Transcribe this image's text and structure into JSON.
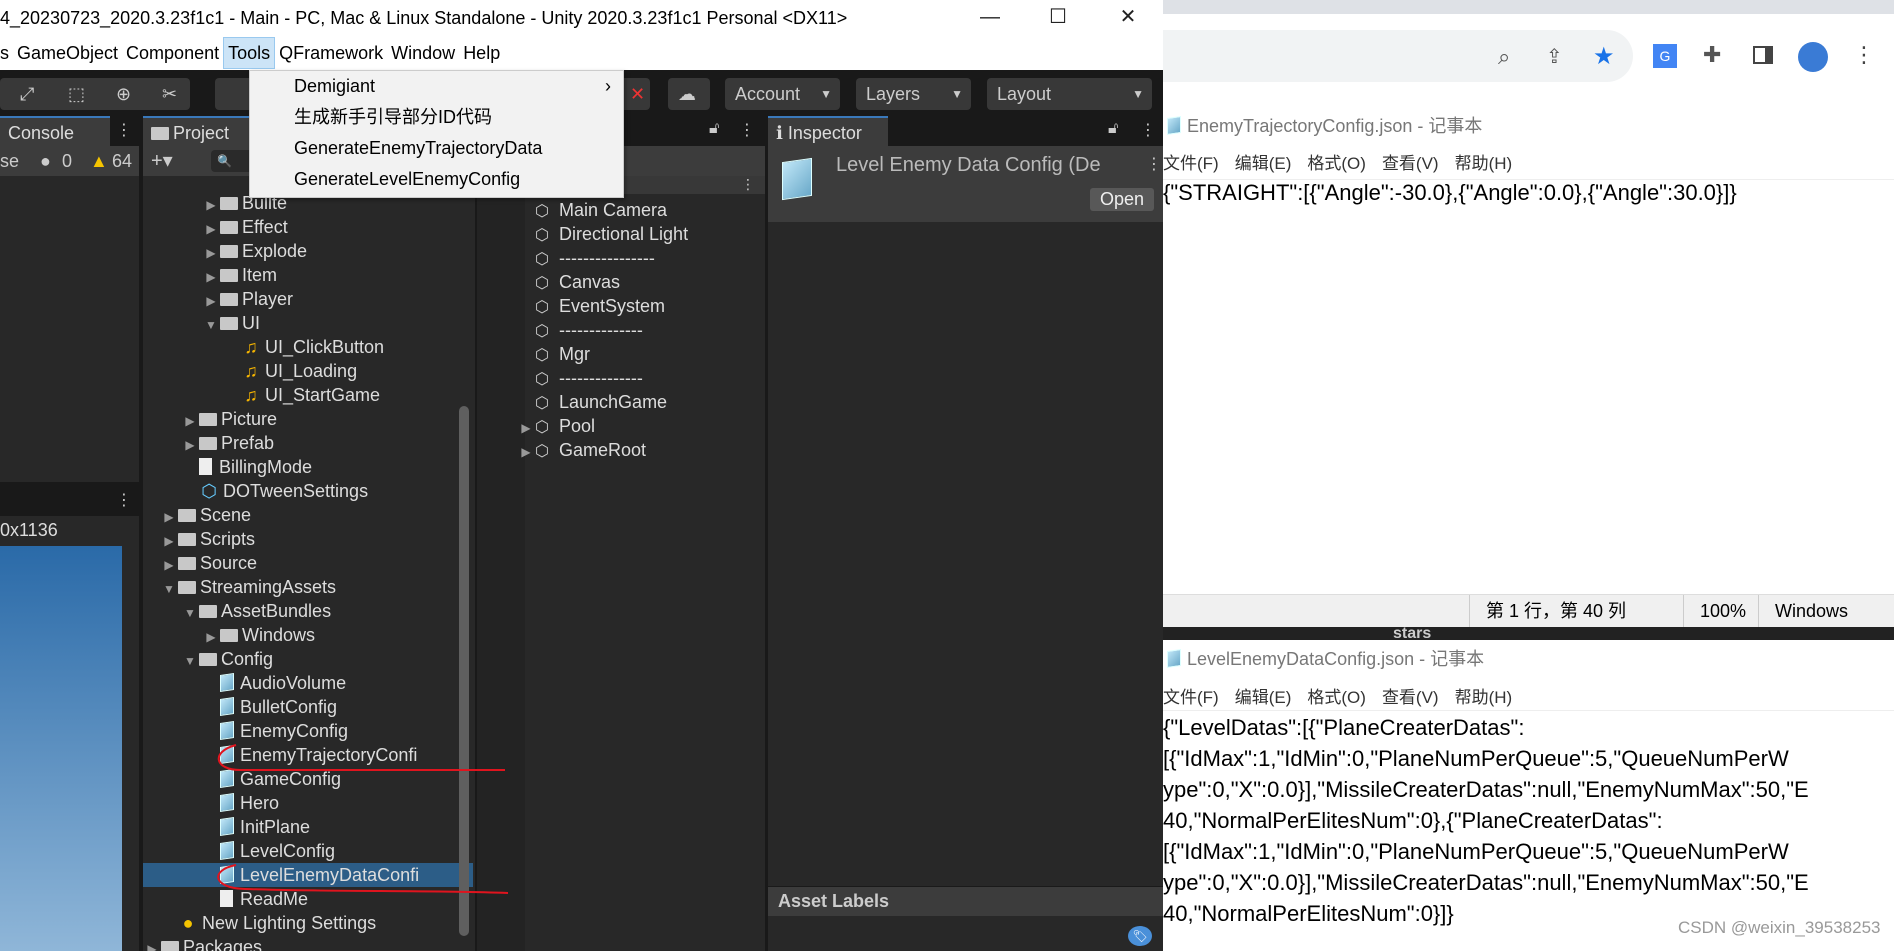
{
  "unity": {
    "title": "4_20230723_2020.3.23f1c1 - Main - PC, Mac & Linux Standalone - Unity 2020.3.23f1c1 Personal <DX11>",
    "menu": [
      "s",
      "GameObject",
      "Component",
      "Tools",
      "QFramework",
      "Window",
      "Help"
    ],
    "tools_menu": [
      "Demigiant",
      "生成新手引导部分ID代码",
      "GenerateEnemyTrajectoryData",
      "GenerateLevelEnemyConfig"
    ],
    "toolbar": {
      "account": "Account",
      "layers": "Layers",
      "layout": "Layout"
    },
    "console": {
      "tab": "Console",
      "collapse": "se",
      "error_count": "0",
      "warning_count": "64"
    },
    "game": {
      "resolution": "0x1136"
    },
    "project": {
      "tab": "Project",
      "items": [
        {
          "label": "Bullte",
          "depth": 3,
          "type": "folder",
          "arrow": "right"
        },
        {
          "label": "Effect",
          "depth": 3,
          "type": "folder",
          "arrow": "right"
        },
        {
          "label": "Explode",
          "depth": 3,
          "type": "folder",
          "arrow": "right"
        },
        {
          "label": "Item",
          "depth": 3,
          "type": "folder",
          "arrow": "right"
        },
        {
          "label": "Player",
          "depth": 3,
          "type": "folder",
          "arrow": "right"
        },
        {
          "label": "UI",
          "depth": 3,
          "type": "folder",
          "arrow": "down"
        },
        {
          "label": "UI_ClickButton",
          "depth": 4,
          "type": "audio"
        },
        {
          "label": "UI_Loading",
          "depth": 4,
          "type": "audio"
        },
        {
          "label": "UI_StartGame",
          "depth": 4,
          "type": "audio"
        },
        {
          "label": "Picture",
          "depth": 2,
          "type": "folder",
          "arrow": "right"
        },
        {
          "label": "Prefab",
          "depth": 2,
          "type": "folder",
          "arrow": "right"
        },
        {
          "label": "BillingMode",
          "depth": 2,
          "type": "file"
        },
        {
          "label": "DOTweenSettings",
          "depth": 2,
          "type": "asset"
        },
        {
          "label": "Scene",
          "depth": 1,
          "type": "folder",
          "arrow": "right"
        },
        {
          "label": "Scripts",
          "depth": 1,
          "type": "folder",
          "arrow": "right"
        },
        {
          "label": "Source",
          "depth": 1,
          "type": "folder",
          "arrow": "right"
        },
        {
          "label": "StreamingAssets",
          "depth": 1,
          "type": "folder",
          "arrow": "down"
        },
        {
          "label": "AssetBundles",
          "depth": 2,
          "type": "folder",
          "arrow": "down"
        },
        {
          "label": "Windows",
          "depth": 3,
          "type": "folder",
          "arrow": "right"
        },
        {
          "label": "Config",
          "depth": 2,
          "type": "folder",
          "arrow": "down"
        },
        {
          "label": "AudioVolume",
          "depth": 3,
          "type": "json"
        },
        {
          "label": "BulletConfig",
          "depth": 3,
          "type": "json"
        },
        {
          "label": "EnemyConfig",
          "depth": 3,
          "type": "json"
        },
        {
          "label": "EnemyTrajectoryConfi",
          "depth": 3,
          "type": "json"
        },
        {
          "label": "GameConfig",
          "depth": 3,
          "type": "json"
        },
        {
          "label": "Hero",
          "depth": 3,
          "type": "json"
        },
        {
          "label": "InitPlane",
          "depth": 3,
          "type": "json"
        },
        {
          "label": "LevelConfig",
          "depth": 3,
          "type": "json"
        },
        {
          "label": "LevelEnemyDataConfi",
          "depth": 3,
          "type": "json",
          "selected": true
        },
        {
          "label": "ReadMe",
          "depth": 3,
          "type": "file"
        },
        {
          "label": "New Lighting Settings",
          "depth": 1,
          "type": "light"
        },
        {
          "label": "Packages",
          "depth": 0,
          "type": "folder",
          "arrow": "right"
        }
      ]
    },
    "hierarchy": {
      "items": [
        {
          "label": "Main Camera"
        },
        {
          "label": "Directional Light"
        },
        {
          "label": "----------------"
        },
        {
          "label": "Canvas"
        },
        {
          "label": "EventSystem"
        },
        {
          "label": "--------------"
        },
        {
          "label": "Mgr"
        },
        {
          "label": "--------------"
        },
        {
          "label": "LaunchGame"
        },
        {
          "label": "Pool",
          "arrow": true
        },
        {
          "label": "GameRoot",
          "arrow": true
        }
      ]
    },
    "inspector": {
      "tab": "Inspector",
      "asset_name": "Level Enemy Data Config (De",
      "open": "Open",
      "asset_labels": "Asset Labels"
    }
  },
  "notepad1": {
    "title": "EnemyTrajectoryConfig.json - 记事本",
    "menu": [
      "文件(F)",
      "编辑(E)",
      "格式(O)",
      "查看(V)",
      "帮助(H)"
    ],
    "lines": [
      "{\"STRAIGHT\":[{\"Angle\":-30.0},{\"Angle\":0.0},{\"Angle\":30.0}]}"
    ],
    "status": {
      "position": "第 1 行，第 40 列",
      "zoom": "100%",
      "eol": "Windows (CRLF"
    }
  },
  "behind_text": "stars",
  "notepad2": {
    "title": "LevelEnemyDataConfig.json - 记事本",
    "menu": [
      "文件(F)",
      "编辑(E)",
      "格式(O)",
      "查看(V)",
      "帮助(H)"
    ],
    "lines": [
      "{\"LevelDatas\":[{\"PlaneCreaterDatas\":",
      "[{\"IdMax\":1,\"IdMin\":0,\"PlaneNumPerQueue\":5,\"QueueNumPerW",
      "ype\":0,\"X\":0.0}],\"MissileCreaterDatas\":null,\"EnemyNumMax\":50,\"E",
      "40,\"NormalPerElitesNum\":0},{\"PlaneCreaterDatas\":",
      "[{\"IdMax\":1,\"IdMin\":0,\"PlaneNumPerQueue\":5,\"QueueNumPerW",
      "ype\":0,\"X\":0.0}],\"MissileCreaterDatas\":null,\"EnemyNumMax\":50,\"E",
      "40,\"NormalPerElitesNum\":0}]}"
    ]
  },
  "watermark": "CSDN @weixin_39538253",
  "colors": {
    "selection": "#2c5d87",
    "annotation": "#e0141e",
    "accent": "#1a73e8"
  }
}
